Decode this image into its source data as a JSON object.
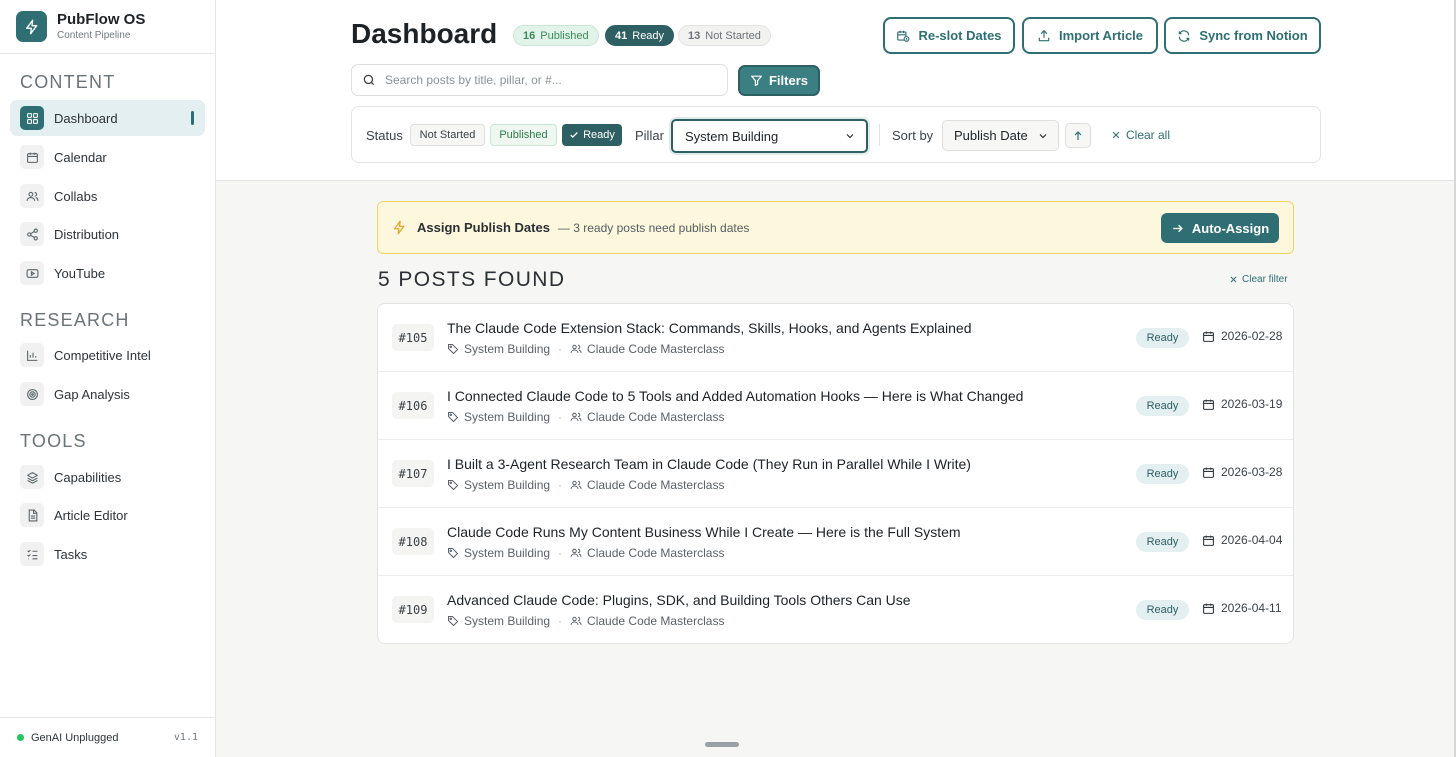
{
  "app": {
    "name": "PubFlow OS",
    "subtitle": "Content Pipeline",
    "icon": "bolt-icon"
  },
  "sidebar": {
    "sections": [
      {
        "title": "CONTENT",
        "items": [
          {
            "label": "Dashboard",
            "icon": "grid-icon",
            "active": true
          },
          {
            "label": "Calendar",
            "icon": "calendar-icon"
          },
          {
            "label": "Collabs",
            "icon": "users-icon"
          },
          {
            "label": "Distribution",
            "icon": "share-icon"
          },
          {
            "label": "YouTube",
            "icon": "video-icon"
          }
        ]
      },
      {
        "title": "RESEARCH",
        "items": [
          {
            "label": "Competitive Intel",
            "icon": "bar-chart-icon"
          },
          {
            "label": "Gap Analysis",
            "icon": "target-icon"
          }
        ]
      },
      {
        "title": "TOOLS",
        "items": [
          {
            "label": "Capabilities",
            "icon": "layers-icon"
          },
          {
            "label": "Article Editor",
            "icon": "document-icon"
          },
          {
            "label": "Tasks",
            "icon": "checklist-icon"
          }
        ]
      }
    ],
    "footer": {
      "workspace": "GenAI Unplugged",
      "version": "v1.1",
      "status_color": "#22c55e"
    }
  },
  "header": {
    "title": "Dashboard",
    "badges": {
      "published": {
        "count": "16",
        "label": "Published"
      },
      "ready": {
        "count": "41",
        "label": "Ready"
      },
      "not_started": {
        "count": "13",
        "label": "Not Started"
      }
    },
    "buttons": {
      "reslot": "Re-slot Dates",
      "import": "Import Article",
      "sync": "Sync from Notion"
    },
    "search": {
      "placeholder": "Search posts by title, pillar, or #...",
      "value": ""
    },
    "filters_label": "Filters"
  },
  "filter_panel": {
    "status_label": "Status",
    "status_chips": {
      "not_started": "Not Started",
      "published": "Published",
      "ready": "Ready"
    },
    "selected_status": "Ready",
    "pillar_label": "Pillar",
    "pillar_value": "System Building",
    "sort_label": "Sort by",
    "sort_value": "Publish Date",
    "sort_direction": "ascending",
    "clear_all": "Clear all"
  },
  "banner": {
    "title": "Assign Publish Dates",
    "description": "— 3 ready posts need publish dates",
    "button": "Auto-Assign"
  },
  "results": {
    "heading": "5 POSTS FOUND",
    "clear_filter": "Clear filter",
    "posts": [
      {
        "number": "#105",
        "title": "The Claude Code Extension Stack: Commands, Skills, Hooks, and Agents Explained",
        "pillar": "System Building",
        "series": "Claude Code Masterclass",
        "status": "Ready",
        "date": "2026-02-28"
      },
      {
        "number": "#106",
        "title": "I Connected Claude Code to 5 Tools and Added Automation Hooks — Here is What Changed",
        "pillar": "System Building",
        "series": "Claude Code Masterclass",
        "status": "Ready",
        "date": "2026-03-19"
      },
      {
        "number": "#107",
        "title": "I Built a 3-Agent Research Team in Claude Code (They Run in Parallel While I Write)",
        "pillar": "System Building",
        "series": "Claude Code Masterclass",
        "status": "Ready",
        "date": "2026-03-28"
      },
      {
        "number": "#108",
        "title": "Claude Code Runs My Content Business While I Create — Here is the Full System",
        "pillar": "System Building",
        "series": "Claude Code Masterclass",
        "status": "Ready",
        "date": "2026-04-04"
      },
      {
        "number": "#109",
        "title": "Advanced Claude Code: Plugins, SDK, and Building Tools Others Can Use",
        "pillar": "System Building",
        "series": "Claude Code Masterclass",
        "status": "Ready",
        "date": "2026-04-11"
      }
    ]
  },
  "colors": {
    "accent": "#2f6f73",
    "accent_dark": "#2d5f63",
    "banner_bg": "#fdf8dd",
    "banner_border": "#f0d46a"
  }
}
